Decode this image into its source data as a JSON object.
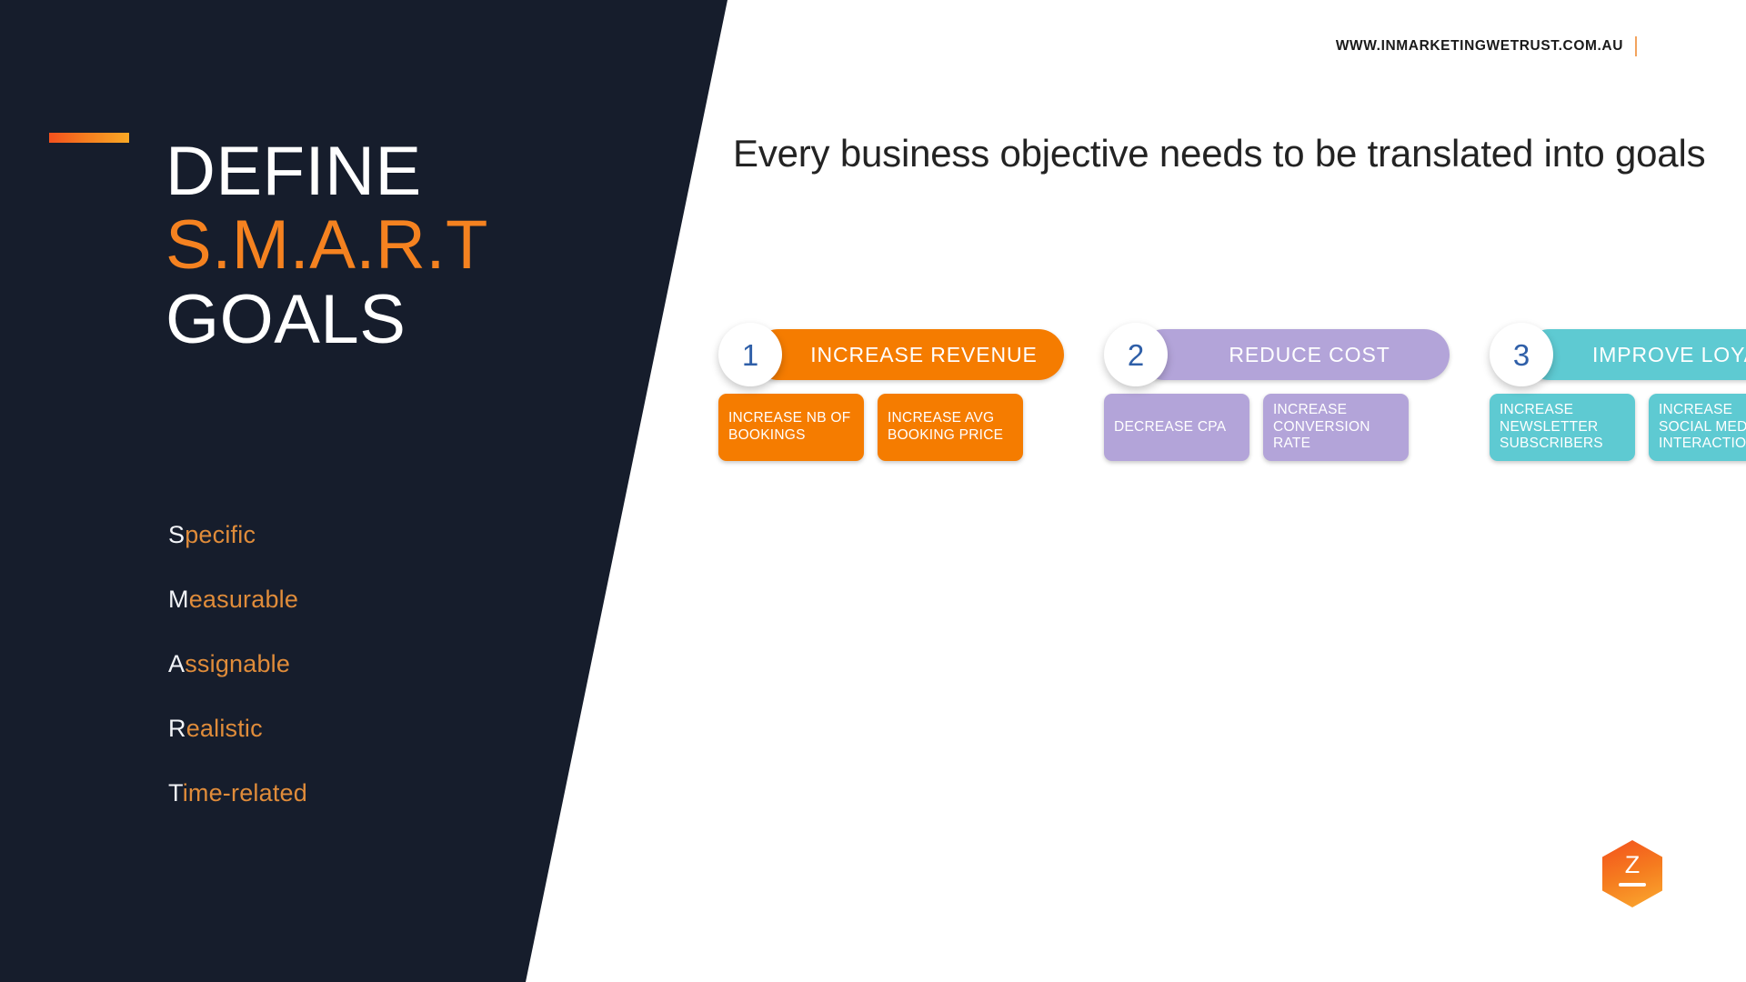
{
  "header": {
    "site_url": "WWW.INMARKETINGWETRUST.COM.AU",
    "divider": "|"
  },
  "left_panel": {
    "title_lines": [
      {
        "text": "DEFINE",
        "accent": false
      },
      {
        "text": "S.M.A.R.T",
        "accent": true
      },
      {
        "text": "GOALS",
        "accent": false
      }
    ],
    "smart_items": [
      {
        "lead": "S",
        "rest": "pecific"
      },
      {
        "lead": "M",
        "rest": "easurable"
      },
      {
        "lead": "A",
        "rest": "ssignable"
      },
      {
        "lead": "R",
        "rest": "ealistic"
      },
      {
        "lead": "T",
        "rest": "ime-related"
      }
    ]
  },
  "main": {
    "heading": "Every business objective needs to be translated into goals",
    "goals": [
      {
        "number": "1",
        "label": "INCREASE REVENUE",
        "color": "#f57c00",
        "subgoals": [
          "INCREASE NB OF BOOKINGS",
          "INCREASE AVG BOOKING PRICE"
        ]
      },
      {
        "number": "2",
        "label": "REDUCE COST",
        "color": "#b3a4d9",
        "subgoals": [
          "DECREASE CPA",
          "INCREASE CONVERSION RATE"
        ]
      },
      {
        "number": "3",
        "label": "IMPROVE LOYALTY",
        "color": "#5ecad2",
        "subgoals": [
          "INCREASE NEWSLETTER SUBSCRIBERS",
          "INCREASE SOCIAL MEDIA INTERACTION"
        ]
      }
    ]
  },
  "logo": {
    "letter": "Z"
  },
  "colors": {
    "panel_dark": "#161d2c",
    "accent_orange": "#f58220",
    "number_blue": "#2f5fa8",
    "goal_orange": "#f57c00",
    "goal_purple": "#b3a4d9",
    "goal_teal": "#5ecad2"
  }
}
